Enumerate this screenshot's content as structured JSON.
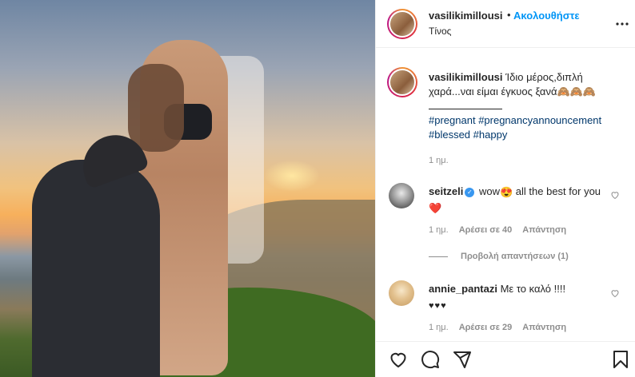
{
  "post": {
    "username": "vasilikimillousi",
    "dot": "•",
    "follow_label": "Ακολουθήστε",
    "location": "Τίνος",
    "caption_text": " Ίδιο μέρος,διπλή χαρά...ναι είμαι έγκυος ξανά",
    "caption_emoji": "🙈🙈🙈",
    "hashtags": [
      "#pregnant",
      "#pregnancyannouncement",
      "#blessed",
      "#happy"
    ],
    "time": "1 ημ."
  },
  "comments": [
    {
      "username": "seitzeli",
      "verified": true,
      "text_a": "wow",
      "emoji_a": "😍",
      "text_b": " all the best for you",
      "emoji_b": "❤️",
      "time": "1 ημ.",
      "likes": "Αρέσει σε 40",
      "reply": "Απάντηση",
      "view_replies": "Προβολή απαντήσεων (1)"
    },
    {
      "username": "annie_pantazi",
      "text": " Με το καλό !!!!",
      "emoji": "♥♥♥",
      "time": "1 ημ.",
      "likes": "Αρέσει σε 29",
      "reply": "Απάντηση"
    }
  ],
  "icons": {
    "more": "more-options-icon",
    "like": "heart-icon",
    "comment": "comment-icon",
    "share": "share-icon",
    "save": "bookmark-icon"
  },
  "colors": {
    "accent": "#0095f6",
    "hashtag": "#00376b",
    "muted": "#8e8e8e",
    "heart": "#ed4956"
  }
}
